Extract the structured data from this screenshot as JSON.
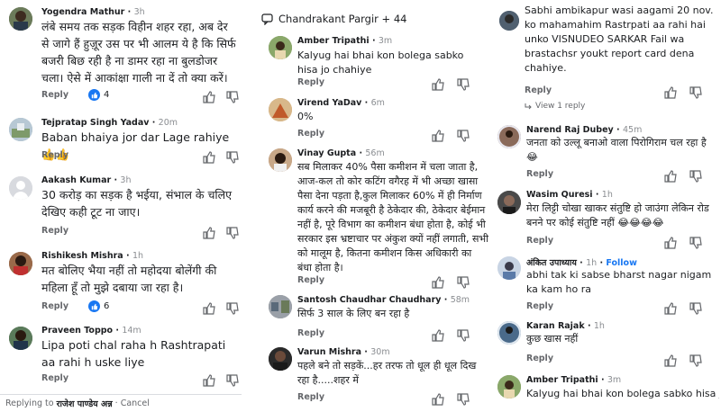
{
  "panel1": {
    "comments": [
      {
        "name": "Yogendra Mathur",
        "time": "3h",
        "text": "लंबे समय तक सड़क विहीन शहर रहा,  अब देर से जागे हैं हुज़ूर उस पर भी आलम ये है कि सिर्फ बजरी बिछ रही है ना डामर रहा ना बुलडोजर चला। ऐसे में आकांक्षा   गाली ना दें तो क्या करें।",
        "reply": "Reply",
        "likes": "4"
      },
      {
        "name": "Tejpratap Singh Yadav",
        "time": "20m",
        "text": "Baban bhaiya jor dar Lage rahiye 👍👍",
        "reply": "Reply"
      },
      {
        "name": "Aakash Kumar",
        "time": "3h",
        "text": "30 करोड़ का सड़क है भईया, संभाल के चलिए देखिए कही टूट ना जाए।",
        "reply": "Reply"
      },
      {
        "name": "Rishikesh Mishra",
        "time": "1h",
        "text": "मत बोलिए भैया नहीं तो महोदया बोलेंगी की महिला हूँ तो मुझे दबाया जा रहा है।",
        "reply": "Reply",
        "likes": "6"
      },
      {
        "name": "Praveen Toppo",
        "time": "14m",
        "text": "Lipa poti chal raha h  Rashtrapati  aa rahi h uske liye",
        "reply": "Reply"
      }
    ],
    "footer": {
      "prefix": "Replying to",
      "target": "राजेश पाण्डेय अन्न",
      "cancel": "· Cancel"
    }
  },
  "panel2": {
    "header": {
      "name": "Chandrakant Pargir + 44"
    },
    "comments": [
      {
        "name": "Amber Tripathi",
        "time": "3m",
        "text": "Kalyug hai bhai kon bolega sabko hisa jo chahiye",
        "reply": "Reply"
      },
      {
        "name": "Virend YaDav",
        "time": "6m",
        "text": "0%",
        "reply": "Reply"
      },
      {
        "name": "Vinay Gupta",
        "time": "56m",
        "text": "सब मिलाकर 40% पैसा कमीशन में चला जाता है, आज-कल तो कोर कटिंग वगैरह में भी अच्छा खासा पैसा देना पड़ता है,कुल मिलाकर 60% में ही निर्माण कार्य करने की मजबूरी है ठेकेदार की, ठेकेदार बेईमान नहीं है, पूरे विभाग का कमीशन बंधा होता है, कोई भी सरकार इस भ्रष्टाचार पर अंकुश क्यों नहीं लगाती, सभी को मालूम है, कितना कमीशन किस अधिकारी का बंधा होता है।",
        "reply": "Reply"
      },
      {
        "name": "Santosh Chaudhar Chaudhary",
        "time": "58m",
        "text": "सिर्फ 3 साल के लिए बन रहा है",
        "reply": "Reply"
      },
      {
        "name": "Varun Mishra",
        "time": "30m",
        "text": "पहले बने तो सड़कें...हर तरफ तो धूल ही धूल दिख रहा है.....शहर में",
        "reply": "Reply"
      }
    ]
  },
  "panel3": {
    "comments": [
      {
        "text": "Sabhi ambikapur wasi aagami 20 nov. ko mahamahim Rastrpati aa rahi hai unko VISNUDEO SARKAR Fail wa brastachsr youkt report card dena chahiye.",
        "reply": "Reply",
        "view_reply": "View 1 reply"
      },
      {
        "name": "Narend Raj Dubey",
        "time": "45m",
        "text": "जनता को उल्लू बनाओ वाला पिरोगिराम चल रहा है 😂",
        "reply": "Reply"
      },
      {
        "name": "Wasim Quresi",
        "time": "1h",
        "text": "मेरा लिट्टी चोखा खाकर संतुष्टि हो जाउंगा लेकिन रोड बनने पर कोई संतुष्टि नहीं 😂😂😂😂",
        "reply": "Reply"
      },
      {
        "name": "अंकित उपाध्याय",
        "time": "1h",
        "follow": "Follow",
        "text": "abhi tak ki sabse bharst nagar nigam ka kam ho ra",
        "reply": "Reply"
      },
      {
        "name": "Karan Rajak",
        "time": "1h",
        "text": "कुछ खास नहीं",
        "reply": "Reply"
      },
      {
        "name": "Amber Tripathi",
        "time": "3m",
        "text": "Kalyug hai bhai kon bolega sabko hisa jo"
      }
    ]
  },
  "colors": {
    "link": "#1877f2",
    "muted": "#65676b",
    "text": "#1c1e21"
  }
}
